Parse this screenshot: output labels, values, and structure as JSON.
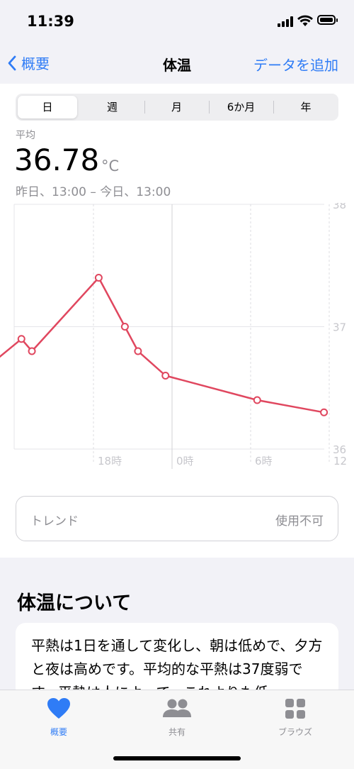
{
  "status": {
    "time": "11:39"
  },
  "nav": {
    "back_label": "概要",
    "title": "体温",
    "action_label": "データを追加"
  },
  "segments": [
    "日",
    "週",
    "月",
    "6か月",
    "年"
  ],
  "summary": {
    "label": "平均",
    "value": "36.78",
    "unit": "°C",
    "range": "昨日、13:00 – 今日、13:00"
  },
  "chart_data": {
    "type": "line",
    "y_ticks": [
      "38",
      "37",
      "36"
    ],
    "x_ticks": [
      "18時",
      "0時",
      "6時",
      "12"
    ],
    "ylim": [
      36,
      38
    ],
    "series": [
      {
        "points": [
          {
            "x": 10.8,
            "y": 36.75
          },
          {
            "x": 12.5,
            "y": 36.9
          },
          {
            "x": 13.3,
            "y": 36.8
          },
          {
            "x": 18.4,
            "y": 37.4
          },
          {
            "x": 20.4,
            "y": 37.0
          },
          {
            "x": 21.4,
            "y": 36.8
          },
          {
            "x": 23.5,
            "y": 36.6
          },
          {
            "x": 30.5,
            "y": 36.4
          },
          {
            "x": 35.6,
            "y": 36.3
          }
        ],
        "color": "#e0475f"
      }
    ]
  },
  "trend": {
    "label": "トレンド",
    "value": "使用不可"
  },
  "about": {
    "title": "体温について",
    "text": "平熱は1日を通して変化し、朝は低めで、夕方と夜は高めです。平均的な平熱は37度弱です。平熱は人によって、これよりも低"
  },
  "tabs": [
    {
      "label": "概要",
      "icon": "heart-icon",
      "active": true
    },
    {
      "label": "共有",
      "icon": "people-icon",
      "active": false
    },
    {
      "label": "ブラウズ",
      "icon": "grid-icon",
      "active": false
    }
  ],
  "colors": {
    "accent": "#2f7cf6",
    "series": "#e0475f"
  }
}
